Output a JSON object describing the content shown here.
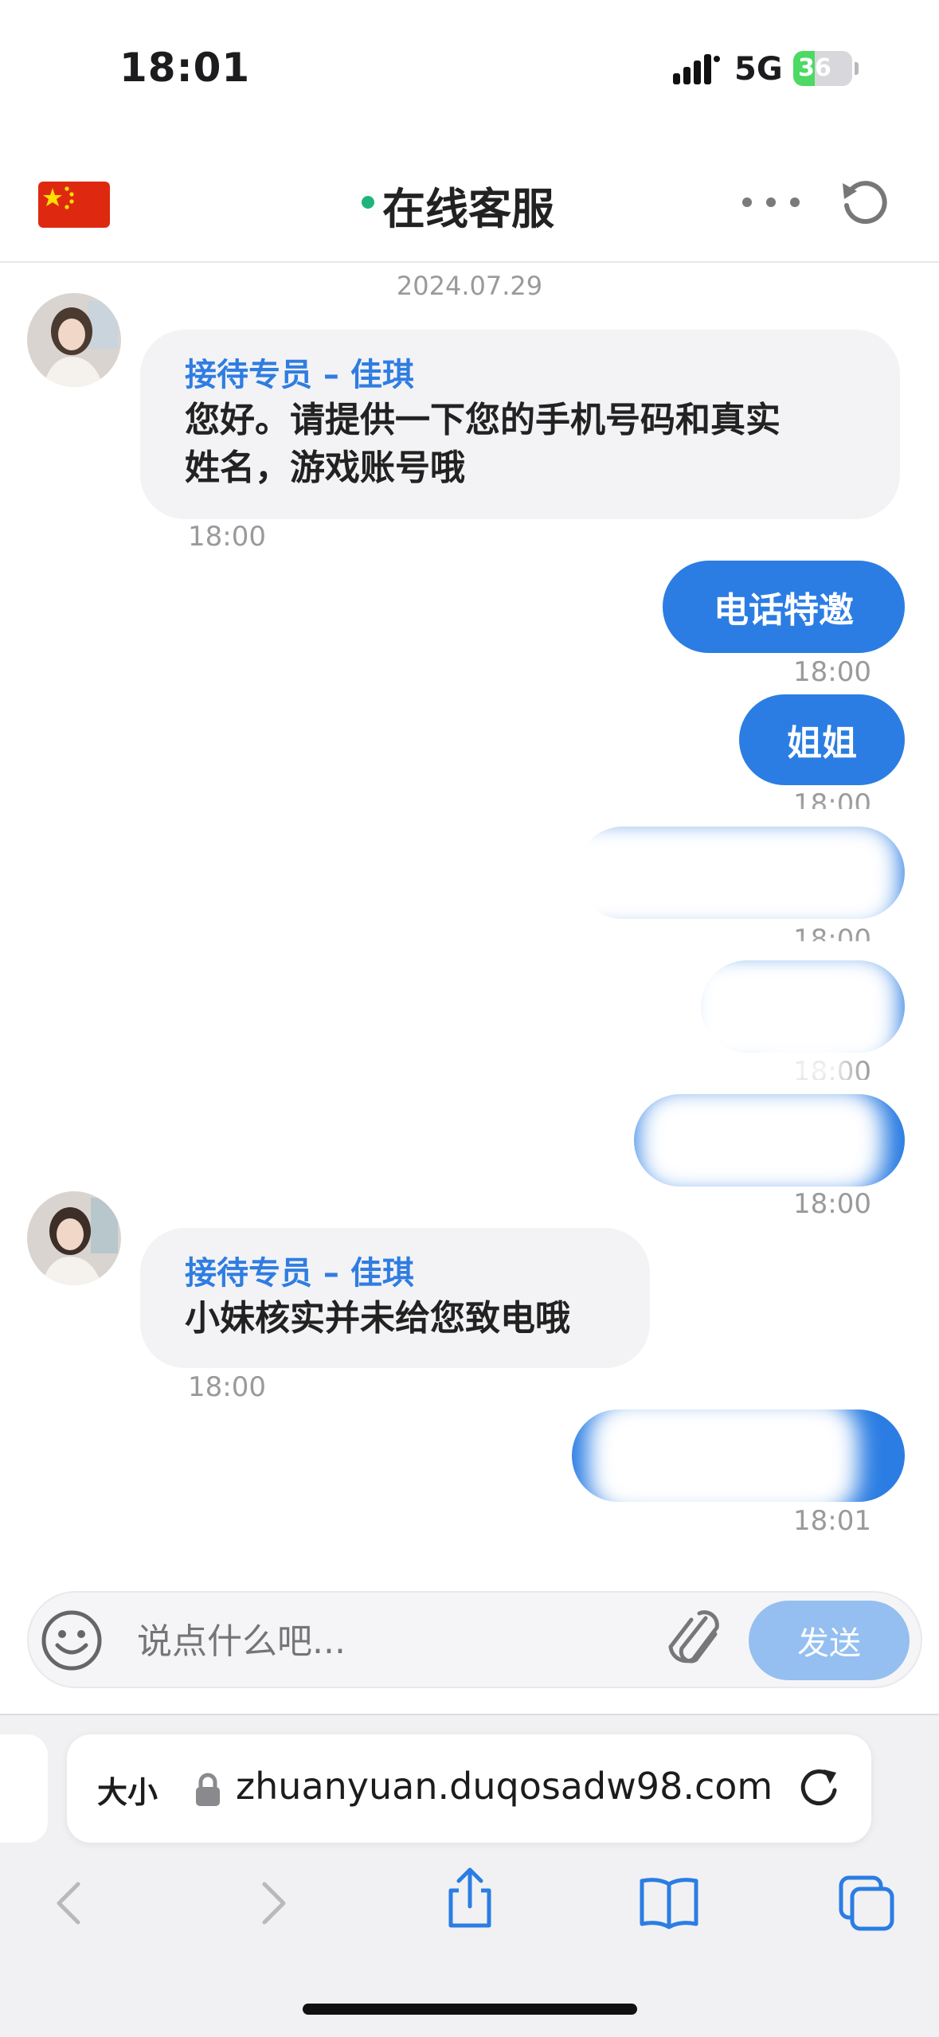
{
  "status_bar": {
    "time": "18:01",
    "network": "5G",
    "battery": "36",
    "battery_fraction": 0.36
  },
  "header": {
    "title": "在线客服"
  },
  "chat": {
    "date": "2024.07.29",
    "messages": [
      {
        "sender": "接待专员 – 佳琪",
        "text_line1": "您好。请提供一下您的手机号码和真实",
        "text_line2": "姓名，游戏账号哦",
        "time": "18:00"
      },
      {
        "text": "电话特邀",
        "time": "18:00"
      },
      {
        "text": "姐姐",
        "time": "18:00"
      },
      {
        "time": "18:00"
      },
      {
        "time": "18:00"
      },
      {
        "time": "18:00"
      },
      {
        "sender": "接待专员 – 佳琪",
        "text": "小妹核实并未给您致电哦",
        "time": "18:00"
      },
      {
        "time": "18:01"
      }
    ]
  },
  "composer": {
    "placeholder": "说点什么吧...",
    "send_label": "发送"
  },
  "browser": {
    "text_size_label": "大小",
    "url": "zhuanyuan.duqosadw98.com"
  },
  "colors": {
    "accent": "#2b7de3",
    "online": "#1fb57a",
    "send_disabled": "#94bff0",
    "agent_name": "#2f7de1"
  },
  "icons": [
    "china-flag-icon",
    "more-icon",
    "refresh-icon",
    "emoji-icon",
    "paperclip-icon",
    "lock-icon",
    "reload-icon",
    "back-icon",
    "forward-icon",
    "share-icon",
    "bookmarks-icon",
    "tabs-icon"
  ]
}
